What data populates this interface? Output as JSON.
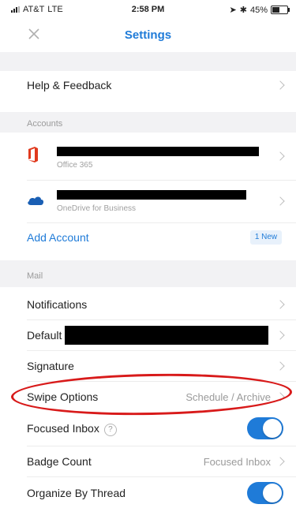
{
  "status_bar": {
    "carrier": "AT&T",
    "network": "LTE",
    "time": "2:58 PM",
    "battery_text": "45%",
    "battery_level": 0.45
  },
  "header": {
    "title": "Settings",
    "close_icon": "close-icon"
  },
  "rows": {
    "help": {
      "label": "Help & Feedback"
    },
    "accounts_section": "Accounts",
    "account_office": {
      "subtitle": "Office 365",
      "icon": "office-icon"
    },
    "account_onedrive": {
      "subtitle": "OneDrive for Business",
      "icon": "onedrive-icon"
    },
    "add_account": {
      "label": "Add Account",
      "badge": "1 New"
    },
    "mail_section": "Mail",
    "notifications": {
      "label": "Notifications"
    },
    "default": {
      "label": "Default"
    },
    "signature": {
      "label": "Signature"
    },
    "swipe": {
      "label": "Swipe Options",
      "value": "Schedule / Archive"
    },
    "focused_inbox": {
      "label": "Focused Inbox",
      "info": "?",
      "enabled": true
    },
    "badge_count": {
      "label": "Badge Count",
      "value": "Focused Inbox"
    },
    "organize_thread": {
      "label": "Organize By Thread",
      "enabled": true
    }
  },
  "colors": {
    "accent": "#1f7bd8",
    "highlight": "#d81a1a",
    "office": "#e03a1e"
  }
}
